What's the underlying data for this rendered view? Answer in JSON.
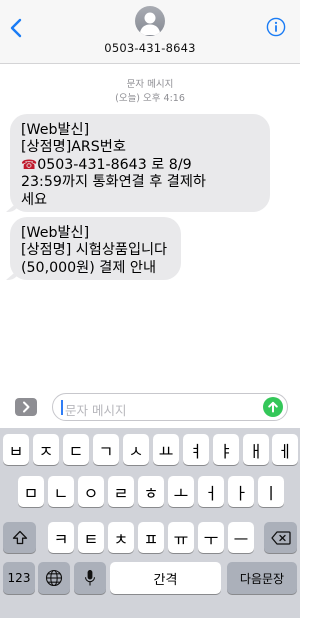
{
  "header": {
    "contact_number": "0503-431-8643"
  },
  "conversation": {
    "message_type": "문자 메시지",
    "timestamp": "(오늘) 오후 4:16",
    "messages": [
      {
        "lines": [
          "[Web발신]",
          "[상점명]ARS번호",
          "0503-431-8643 로 8/9",
          "23:59까지 통화연결 후 결제하",
          "세요"
        ],
        "emoji": "☎"
      },
      {
        "lines": [
          "[Web발신]",
          "[상점명] 시험상품입니다",
          "(50,000원) 결제 안내"
        ]
      }
    ]
  },
  "composer": {
    "placeholder": "문자 메시지",
    "accent_color": "#34c759"
  },
  "keyboard": {
    "row1": [
      "ㅂ",
      "ㅈ",
      "ㄷ",
      "ㄱ",
      "ㅅ",
      "ㅛ",
      "ㅕ",
      "ㅑ",
      "ㅐ",
      "ㅔ"
    ],
    "row2": [
      "ㅁ",
      "ㄴ",
      "ㅇ",
      "ㄹ",
      "ㅎ",
      "ㅗ",
      "ㅓ",
      "ㅏ",
      "ㅣ"
    ],
    "row3": [
      "ㅋ",
      "ㅌ",
      "ㅊ",
      "ㅍ",
      "ㅠ",
      "ㅜ",
      "ㅡ"
    ],
    "numbers_label": "123",
    "space_label": "간격",
    "return_label": "다음문장"
  },
  "icons": {
    "back": "chevron-left-icon",
    "info": "info-icon",
    "apps": "chevron-right-icon",
    "send": "arrow-up-icon",
    "shift": "shift-icon",
    "delete": "delete-icon",
    "globe": "globe-icon",
    "mic": "microphone-icon"
  }
}
